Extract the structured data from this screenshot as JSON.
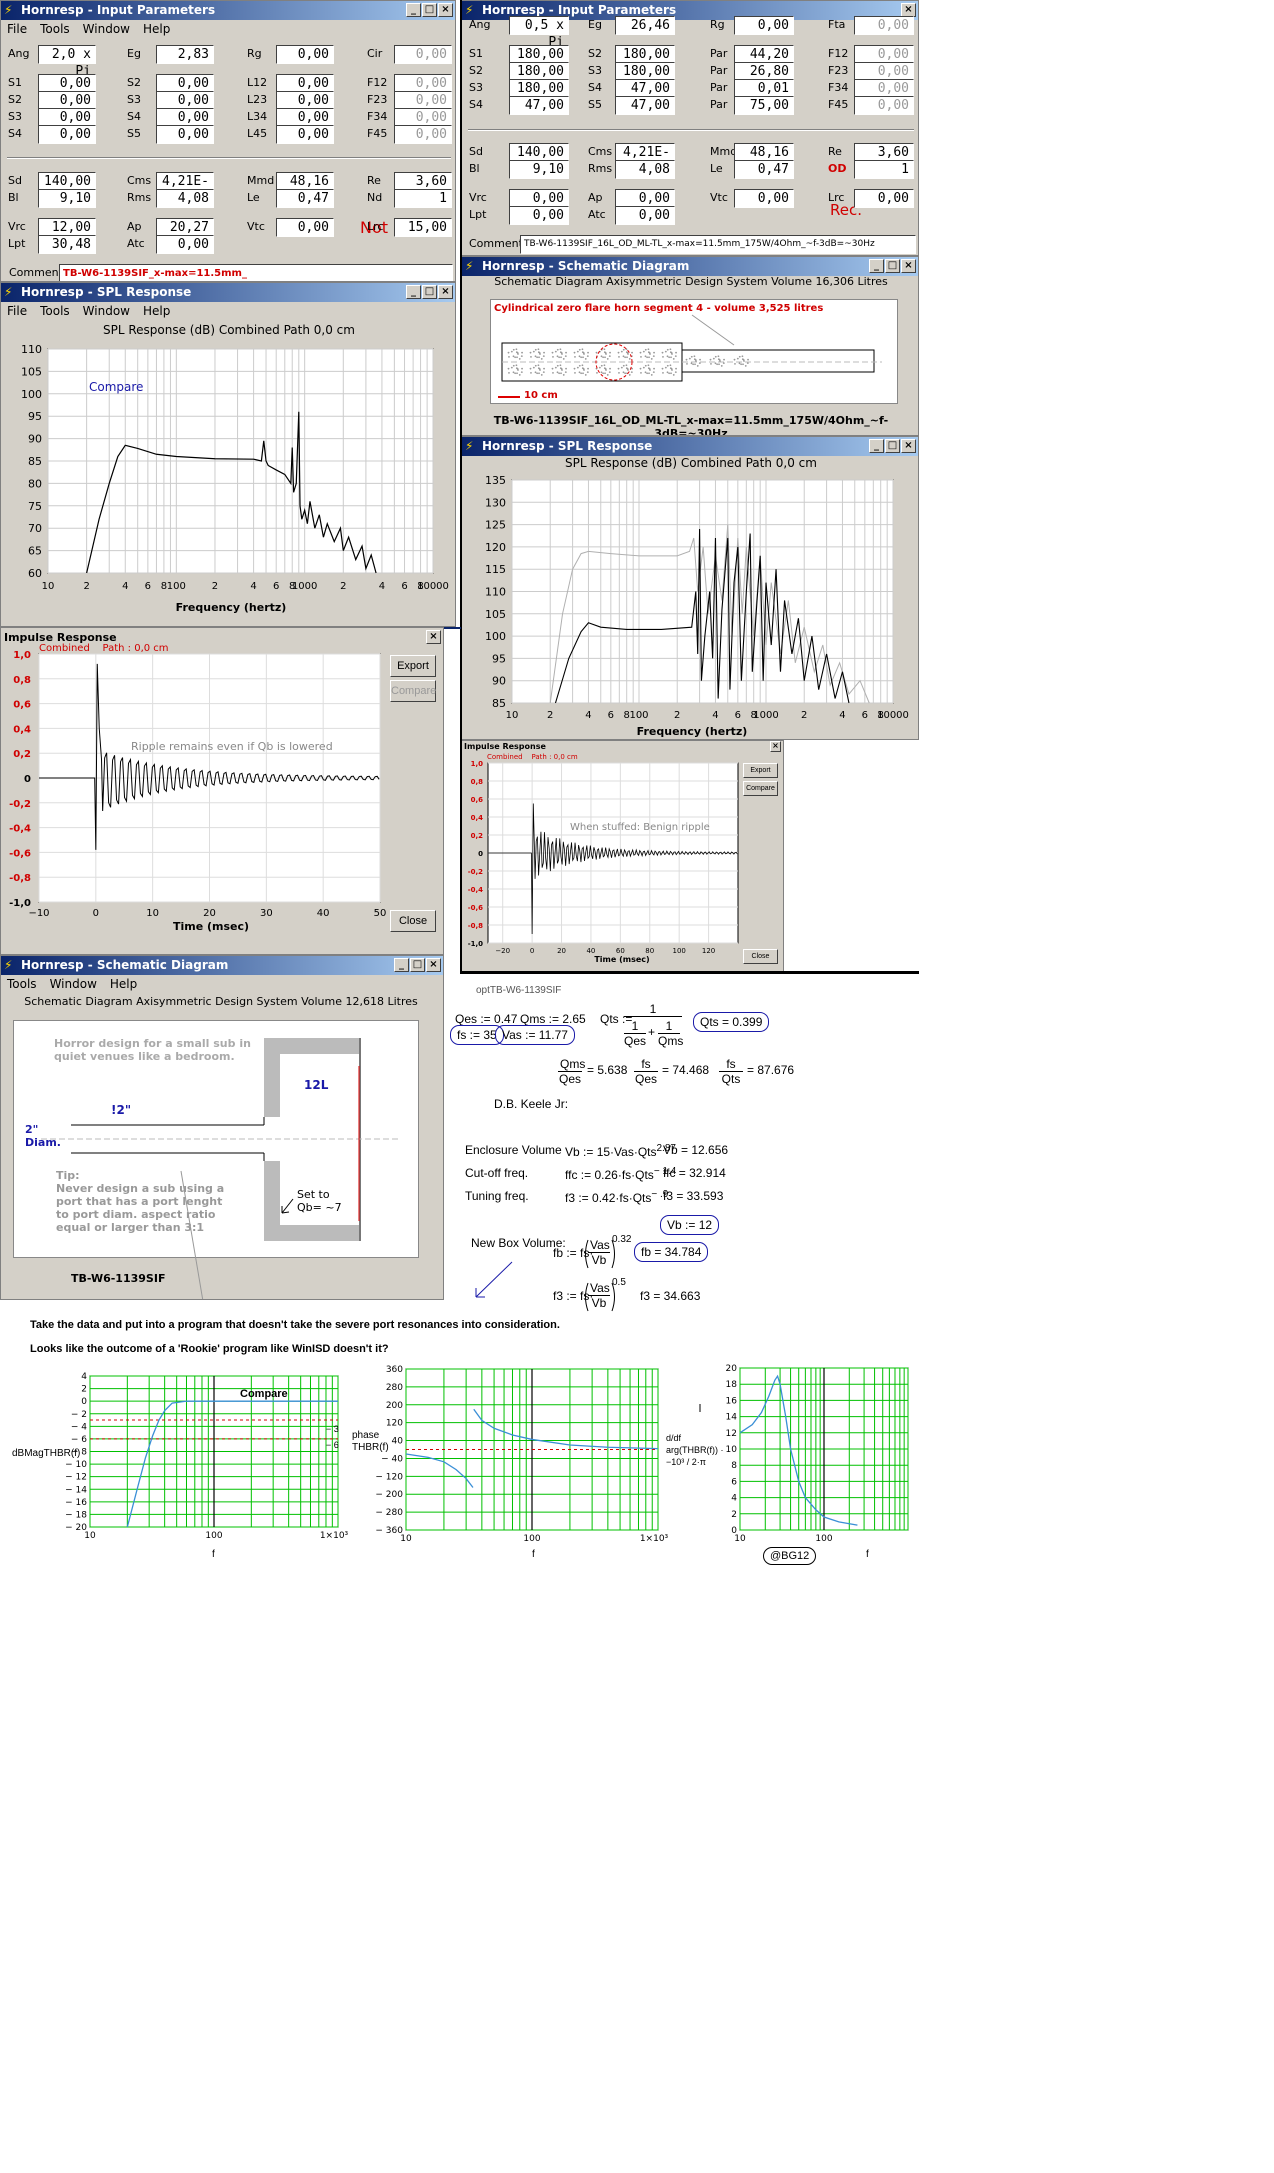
{
  "win_ip1": {
    "title": "Hornresp - Input Parameters",
    "menu": [
      "File",
      "Tools",
      "Window",
      "Help"
    ],
    "fields": [
      {
        "l": "Ang",
        "v": "2,0 x Pi"
      },
      {
        "l": "Eg",
        "v": "2,83"
      },
      {
        "l": "Rg",
        "v": "0,00"
      },
      {
        "l": "Cir",
        "v": "0,00"
      },
      {
        "l": "S1",
        "v": "0,00"
      },
      {
        "l": "S2",
        "v": "0,00"
      },
      {
        "l": "L12",
        "v": "0,00"
      },
      {
        "l": "F12",
        "v": "0,00"
      },
      {
        "l": "S2",
        "v": "0,00"
      },
      {
        "l": "S3",
        "v": "0,00"
      },
      {
        "l": "L23",
        "v": "0,00"
      },
      {
        "l": "F23",
        "v": "0,00"
      },
      {
        "l": "S3",
        "v": "0,00"
      },
      {
        "l": "S4",
        "v": "0,00"
      },
      {
        "l": "L34",
        "v": "0,00"
      },
      {
        "l": "F34",
        "v": "0,00"
      },
      {
        "l": "S4",
        "v": "0,00"
      },
      {
        "l": "S5",
        "v": "0,00"
      },
      {
        "l": "L45",
        "v": "0,00"
      },
      {
        "l": "F45",
        "v": "0,00"
      },
      {
        "l": "Sd",
        "v": "140,00"
      },
      {
        "l": "Cms",
        "v": "4,21E-04"
      },
      {
        "l": "Mmd",
        "v": "48,16"
      },
      {
        "l": "Re",
        "v": "3,60"
      },
      {
        "l": "Bl",
        "v": "9,10"
      },
      {
        "l": "Rms",
        "v": "4,08"
      },
      {
        "l": "Le",
        "v": "0,47"
      },
      {
        "l": "Nd",
        "v": "1"
      },
      {
        "l": "Vrc",
        "v": "12,00"
      },
      {
        "l": "Ap",
        "v": "20,27"
      },
      {
        "l": "Vtc",
        "v": "0,00"
      },
      {
        "l": "Lrc",
        "v": "15,00"
      },
      {
        "l": "Lpt",
        "v": "30,48"
      },
      {
        "l": "Atc",
        "v": "0,00"
      }
    ],
    "status": "Not Rec.",
    "comment_label": "Comment",
    "comment": "TB-W6-1139SIF_x-max=11.5mm_"
  },
  "win_spl1": {
    "title": "Hornresp - SPL Response",
    "menu": [
      "File",
      "Tools",
      "Window",
      "Help"
    ],
    "chart_title": "SPL Response (dB)   Combined   Path 0,0 cm",
    "compare": "Compare",
    "xlabel": "Frequency (hertz)"
  },
  "win_imp1": {
    "title": "Impulse Response",
    "legend": "Combined    Path : 0,0 cm",
    "note": "Ripple remains even if Qb is lowered",
    "export": "Export",
    "compare": "Compare",
    "close": "Close",
    "xlabel": "Time (msec)"
  },
  "win_sch1": {
    "title": "Hornresp - Schematic Diagram",
    "menu": [
      "Tools",
      "Window",
      "Help"
    ],
    "header": "Schematic Diagram   Axisymmetric Design   System Volume 12,618 Litres",
    "note1": "Horror design for a small sub in quiet venues like a bedroom.",
    "vol": "12L",
    "port": "!2\"",
    "diam": "2\" Diam.",
    "tip": "Tip:\n Never design a sub using a port that has a port lenght to port diam. aspect ratio equal or larger than 3:1",
    "setto": "Set to Qb= ~7",
    "footer": "TB-W6-1139SIF"
  },
  "win_ip2": {
    "title": "Hornresp - Input Parameters",
    "fields": [
      {
        "l": "Ang",
        "v": "0,5 x Pi"
      },
      {
        "l": "Eg",
        "v": "26,46"
      },
      {
        "l": "Rg",
        "v": "0,00"
      },
      {
        "l": "Fta",
        "v": "0,00"
      },
      {
        "l": "S1",
        "v": "180,00"
      },
      {
        "l": "S2",
        "v": "180,00"
      },
      {
        "l": "Par",
        "v": "44,20"
      },
      {
        "l": "F12",
        "v": "0,00"
      },
      {
        "l": "S2",
        "v": "180,00"
      },
      {
        "l": "S3",
        "v": "180,00"
      },
      {
        "l": "Par",
        "v": "26,80"
      },
      {
        "l": "F23",
        "v": "0,00"
      },
      {
        "l": "S3",
        "v": "180,00"
      },
      {
        "l": "S4",
        "v": "47,00"
      },
      {
        "l": "Par",
        "v": "0,01"
      },
      {
        "l": "F34",
        "v": "0,00"
      },
      {
        "l": "S4",
        "v": "47,00"
      },
      {
        "l": "S5",
        "v": "47,00"
      },
      {
        "l": "Par",
        "v": "75,00"
      },
      {
        "l": "F45",
        "v": "0,00"
      },
      {
        "l": "Sd",
        "v": "140,00"
      },
      {
        "l": "Cms",
        "v": "4,21E-04"
      },
      {
        "l": "Mmd",
        "v": "48,16"
      },
      {
        "l": "Re",
        "v": "3,60"
      },
      {
        "l": "Bl",
        "v": "9,10"
      },
      {
        "l": "Rms",
        "v": "4,08"
      },
      {
        "l": "Le",
        "v": "0,47"
      },
      {
        "l": "OD",
        "v": "1"
      },
      {
        "l": "Vrc",
        "v": "0,00"
      },
      {
        "l": "Ap",
        "v": "0,00"
      },
      {
        "l": "Vtc",
        "v": "0,00"
      },
      {
        "l": "Lrc",
        "v": "0,00"
      },
      {
        "l": "Lpt",
        "v": "0,00"
      },
      {
        "l": "Atc",
        "v": "0,00"
      }
    ],
    "status": "Rec.",
    "comment_label": "Comment",
    "comment": "TB-W6-1139SIF_16L_OD_ML-TL_x-max=11.5mm_175W/4Ohm_~f-3dB=~30Hz"
  },
  "win_sch2": {
    "title": "Hornresp - Schematic Diagram",
    "header": "Schematic Diagram   Axisymmetric Design   System Volume 16,306 Litres",
    "seg": "Cylindrical zero flare horn segment 4 - volume 3,525 litres",
    "scale": "10 cm",
    "footer": "TB-W6-1139SIF_16L_OD_ML-TL_x-max=11.5mm_175W/4Ohm_~f-3dB=~30Hz"
  },
  "win_spl2": {
    "title": "Hornresp - SPL Response",
    "chart_title": "SPL Response (dB)   Combined   Path 0,0 cm",
    "xlabel": "Frequency (hertz)"
  },
  "win_imp2": {
    "title": "Impulse Response",
    "legend": "Combined    Path : 0,0 cm",
    "note": "When stuffed: Benign ripple",
    "export": "Export",
    "compare": "Compare",
    "close": "Close",
    "xlabel": "Time (msec)"
  },
  "math": {
    "opt": "optTB-W6-1139SIF",
    "qes": "Qes := 0.47",
    "qms": "Qms := 2.65",
    "fs": "fs := 35",
    "vas": "Vas := 11.77",
    "qts_def": "Qts :=",
    "qts": "Qts = 0.399",
    "r1": "= 5.638",
    "r2": "= 74.468",
    "r3": "= 87.676",
    "keele": "D.B. Keele Jr:",
    "enc": "Enclosure Volume",
    "enc_eq": "Vb := 15·Vas·Qts",
    "enc_exp": "2.87",
    "enc_r": "Vb = 12.656",
    "cut": "Cut-off freq.",
    "cut_eq": "ffc := 0.26·fs·Qts",
    "cut_exp": "− 1.4",
    "cut_r": "ffc = 32.914",
    "tun": "Tuning freq.",
    "tun_eq": "f3 := 0.42·fs·Qts",
    "tun_exp": "− .9",
    "tun_r": "f3 = 33.593",
    "vb12": "Vb := 12",
    "nbv": "New Box Volume:",
    "fb_eq": "fb := fs·",
    "fb_exp": "0.32",
    "fb_r": "fb = 34.784",
    "f3_eq": "f3 := fs·",
    "f3_exp": "0.5",
    "f3_r": "f3 = 34.663"
  },
  "notes": {
    "n1": "Take the data and put into a program that doesn't take the severe port resonances into consideration.",
    "n2": "Looks like the outcome of a 'Rookie' program like WinISD doesn't it?"
  },
  "mplots": {
    "p1_ylabel": "dBMagTHBR(f)",
    "p1_compare": "Compare",
    "p1_marks": [
      "− 3",
      "− 6"
    ],
    "p2_ylabel": "phase THBR(f)",
    "p3_ylabel": "d/df arg(THBR(f)) · −10³ / 2·π",
    "xlabel": "f",
    "sign": "@BG12"
  },
  "colors": {
    "title_bar": "#0a246a",
    "status_red": "#d00000",
    "mathcad_blue": "#3a8fd6",
    "mathcad_green": "#00c000"
  }
}
